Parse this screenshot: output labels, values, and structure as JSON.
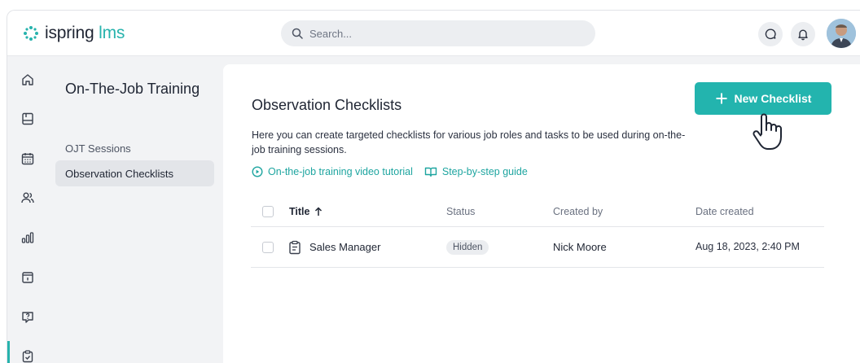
{
  "brand": {
    "name_main": "ispring",
    "name_sub": "lms",
    "accent": "#27b3ad"
  },
  "header": {
    "search_placeholder": "Search...",
    "icons": [
      "chat-icon",
      "bell-icon"
    ]
  },
  "rail": {
    "icons": [
      "home-icon",
      "courses-icon",
      "calendar-icon",
      "users-icon",
      "reports-icon",
      "info-icon",
      "quiz-icon",
      "checklist-icon"
    ]
  },
  "subnav": {
    "title": "On-The-Job Training",
    "items": [
      {
        "label": "OJT Sessions",
        "active": false
      },
      {
        "label": "Observation Checklists",
        "active": true
      }
    ]
  },
  "main": {
    "title": "Observation Checklists",
    "description": "Here you can create targeted checklists for various job roles and tasks to be used during on-the-job training sessions.",
    "links": [
      {
        "label": "On-the-job training video tutorial",
        "icon": "play-icon"
      },
      {
        "label": "Step-by-step guide",
        "icon": "book-icon"
      }
    ],
    "new_button_label": "New Checklist"
  },
  "table": {
    "columns": {
      "title": "Title",
      "status": "Status",
      "created_by": "Created by",
      "date_created": "Date created"
    },
    "rows": [
      {
        "title": "Sales Manager",
        "status": "Hidden",
        "created_by": "Nick Moore",
        "date_created": "Aug 18, 2023, 2:40 PM"
      }
    ]
  }
}
